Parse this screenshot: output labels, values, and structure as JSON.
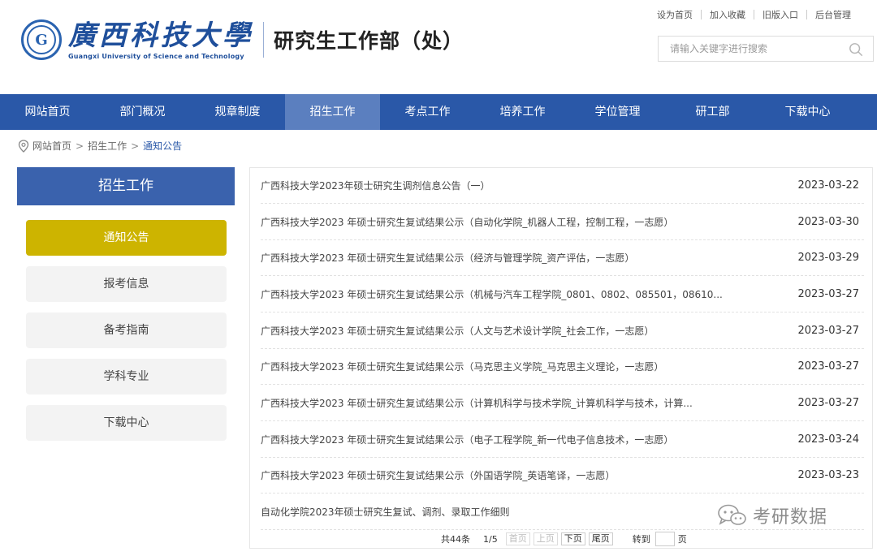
{
  "header": {
    "logo_mark": "G",
    "brand_cn": "廣西科技大學",
    "brand_en": "Guangxi University of Science and Technology",
    "dept": "研究生工作部（处）",
    "toplinks": [
      "设为首页",
      "加入收藏",
      "旧版入口",
      "后台管理"
    ],
    "search_placeholder": "请输入关键字进行搜索"
  },
  "nav": {
    "items": [
      "网站首页",
      "部门概况",
      "规章制度",
      "招生工作",
      "考点工作",
      "培养工作",
      "学位管理",
      "研工部",
      "下载中心"
    ],
    "active_index": 3
  },
  "breadcrumb": {
    "home": "网站首页",
    "section": "招生工作",
    "current": "通知公告",
    "sep": ">"
  },
  "sidebar": {
    "title": "招生工作",
    "items": [
      "通知公告",
      "报考信息",
      "备考指南",
      "学科专业",
      "下载中心"
    ],
    "active_index": 0
  },
  "list": [
    {
      "title": "广西科技大学2023年硕士研究生调剂信息公告（一）",
      "date": "2023-03-22"
    },
    {
      "title": "广西科技大学2023 年硕士研究生复试结果公示（自动化学院_机器人工程，控制工程，一志愿）",
      "date": "2023-03-30"
    },
    {
      "title": "广西科技大学2023 年硕士研究生复试结果公示（经济与管理学院_资产评估，一志愿）",
      "date": "2023-03-29"
    },
    {
      "title": "广西科技大学2023 年硕士研究生复试结果公示（机械与汽车工程学院_0801、0802、085501，08610...",
      "date": "2023-03-27"
    },
    {
      "title": "广西科技大学2023 年硕士研究生复试结果公示（人文与艺术设计学院_社会工作，一志愿）",
      "date": "2023-03-27"
    },
    {
      "title": "广西科技大学2023 年硕士研究生复试结果公示（马克思主义学院_马克思主义理论，一志愿）",
      "date": "2023-03-27"
    },
    {
      "title": "广西科技大学2023 年硕士研究生复试结果公示（计算机科学与技术学院_计算机科学与技术，计算...",
      "date": "2023-03-27"
    },
    {
      "title": "广西科技大学2023 年硕士研究生复试结果公示（电子工程学院_新一代电子信息技术，一志愿）",
      "date": "2023-03-24"
    },
    {
      "title": "广西科技大学2023 年硕士研究生复试结果公示（外国语学院_英语笔译，一志愿）",
      "date": "2023-03-23"
    },
    {
      "title": "自动化学院2023年硕士研究生复试、调剂、录取工作细则",
      "date": ""
    }
  ],
  "pager": {
    "total": "共44条",
    "page": "1/5",
    "first": "首页",
    "prev": "上页",
    "next": "下页",
    "last": "尾页",
    "goto": "转到",
    "page_unit": "页"
  },
  "watermark": {
    "text": "考研数据"
  },
  "colors": {
    "nav": "#2a58a8",
    "nav_active": "#5b7fbf",
    "side_title": "#3a62ad",
    "side_active": "#cdb400"
  }
}
